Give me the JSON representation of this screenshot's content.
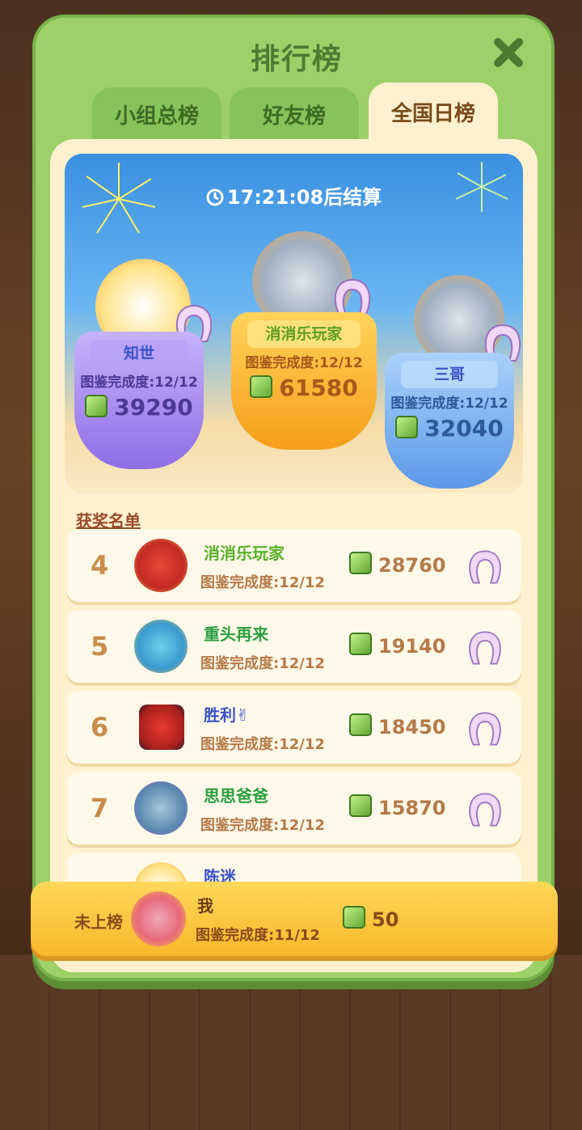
{
  "title": "排行榜",
  "tabs": [
    {
      "label": "小组总榜",
      "active": false
    },
    {
      "label": "好友榜",
      "active": false
    },
    {
      "label": "全国日榜",
      "active": true
    }
  ],
  "timer": "17:21:08后结算",
  "podium": [
    {
      "rank": 2,
      "name": "知世",
      "completion": "图鉴完成度:12/12",
      "score": "39290"
    },
    {
      "rank": 1,
      "name": "消消乐玩家",
      "completion": "图鉴完成度:12/12",
      "score": "61580"
    },
    {
      "rank": 3,
      "name": "三哥",
      "completion": "图鉴完成度:12/12",
      "score": "32040"
    }
  ],
  "awards_title": "获奖名单",
  "rows": [
    {
      "rank": "4",
      "name": "消消乐玩家",
      "completion": "图鉴完成度:12/12",
      "score": "28760"
    },
    {
      "rank": "5",
      "name": "重头再来",
      "completion": "图鉴完成度:12/12",
      "score": "19140"
    },
    {
      "rank": "6",
      "name": "胜利✌",
      "completion": "图鉴完成度:12/12",
      "score": "18450"
    },
    {
      "rank": "7",
      "name": "思思爸爸",
      "completion": "图鉴完成度:12/12",
      "score": "15870"
    },
    {
      "rank": "",
      "name": "陈迷",
      "completion": "",
      "score": ""
    }
  ],
  "me": {
    "status": "未上榜",
    "name": "我",
    "completion": "图鉴完成度:11/12",
    "score": "50"
  },
  "colors": {
    "panel": "#9ed06a",
    "gold": "#ffb020",
    "purple": "#a98bf0",
    "blue": "#6aa8ef"
  },
  "icons": [
    "close-icon",
    "clock-icon",
    "gem-icon",
    "cushion-icon"
  ]
}
